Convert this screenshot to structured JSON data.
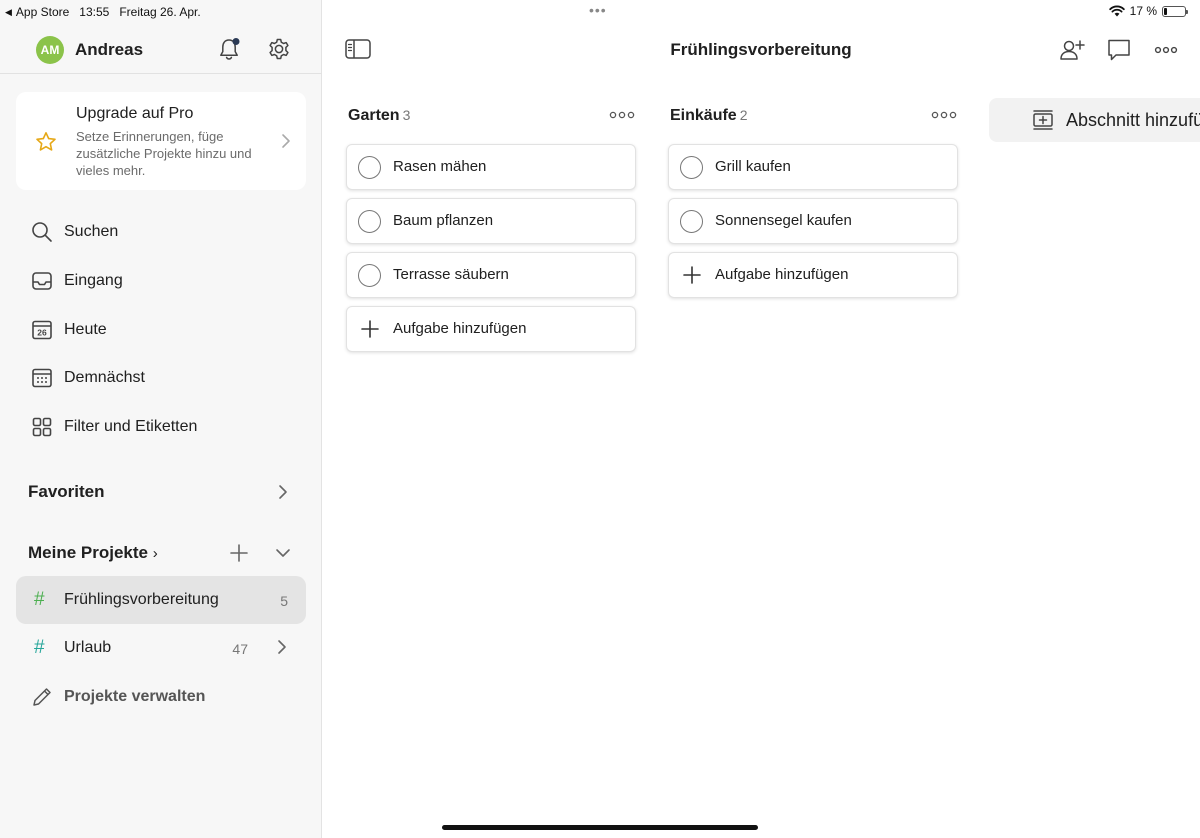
{
  "status_bar": {
    "back_label": "App Store",
    "time": "13:55",
    "date": "Freitag 26. Apr.",
    "battery": "17 %",
    "battery_level": 0.17
  },
  "sidebar": {
    "user": {
      "initials": "AM",
      "name": "Andreas",
      "avatar_color": "#8bc34a"
    },
    "upgrade": {
      "title": "Upgrade auf Pro",
      "text": "Setze Erinnerungen, füge zusätzliche Projekte hinzu und vieles mehr."
    },
    "nav": [
      {
        "label": "Suchen",
        "icon": "search-icon"
      },
      {
        "label": "Eingang",
        "icon": "inbox-icon"
      },
      {
        "label": "Heute",
        "icon": "calendar-today-icon",
        "icon_text": "26"
      },
      {
        "label": "Demnächst",
        "icon": "calendar-upcoming-icon"
      },
      {
        "label": "Filter und Etiketten",
        "icon": "filters-grid-icon"
      }
    ],
    "favorites_label": "Favoriten",
    "projects_label": "Meine Projekte",
    "projects": [
      {
        "label": "Frühlingsvorbereitung",
        "count": "5",
        "color": "#4caf50",
        "active": true
      },
      {
        "label": "Urlaub",
        "count": "47",
        "color": "#26a69a",
        "active": false
      }
    ],
    "manage_label": "Projekte verwalten"
  },
  "main": {
    "title": "Frühlingsvorbereitung",
    "columns": [
      {
        "title": "Garten",
        "count": "3",
        "tasks": [
          "Rasen mähen",
          "Baum pflanzen",
          "Terrasse säubern"
        ],
        "add_label": "Aufgabe hinzufügen"
      },
      {
        "title": "Einkäufe",
        "count": "2",
        "tasks": [
          "Grill kaufen",
          "Sonnensegel kaufen"
        ],
        "add_label": "Aufgabe hinzufügen"
      }
    ],
    "add_section_label": "Abschnitt hinzufügen"
  },
  "colors": {
    "accent": "#e6a817",
    "icon": "#444444"
  }
}
